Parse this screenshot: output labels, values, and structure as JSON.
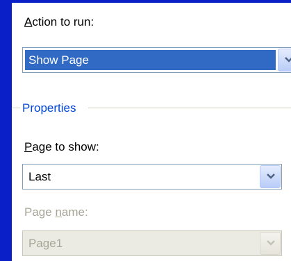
{
  "action": {
    "label_mnemonic": "A",
    "label_rest": "ction to run:",
    "selected": "Show Page"
  },
  "properties": {
    "title": "Properties",
    "page_to_show": {
      "label_mnemonic": "P",
      "label_rest": "age to show:",
      "selected": "Last"
    },
    "page_name": {
      "label_before": "Page ",
      "label_mnemonic": "n",
      "label_after": "ame:",
      "value": "Page1",
      "disabled": true
    }
  },
  "icons": {
    "dropdown": "chevron-down-icon"
  },
  "colors": {
    "window_frame": "#0a1fc8",
    "selection": "#316ac5",
    "group_title": "#0046d5",
    "disabled_text": "#a7a597"
  }
}
